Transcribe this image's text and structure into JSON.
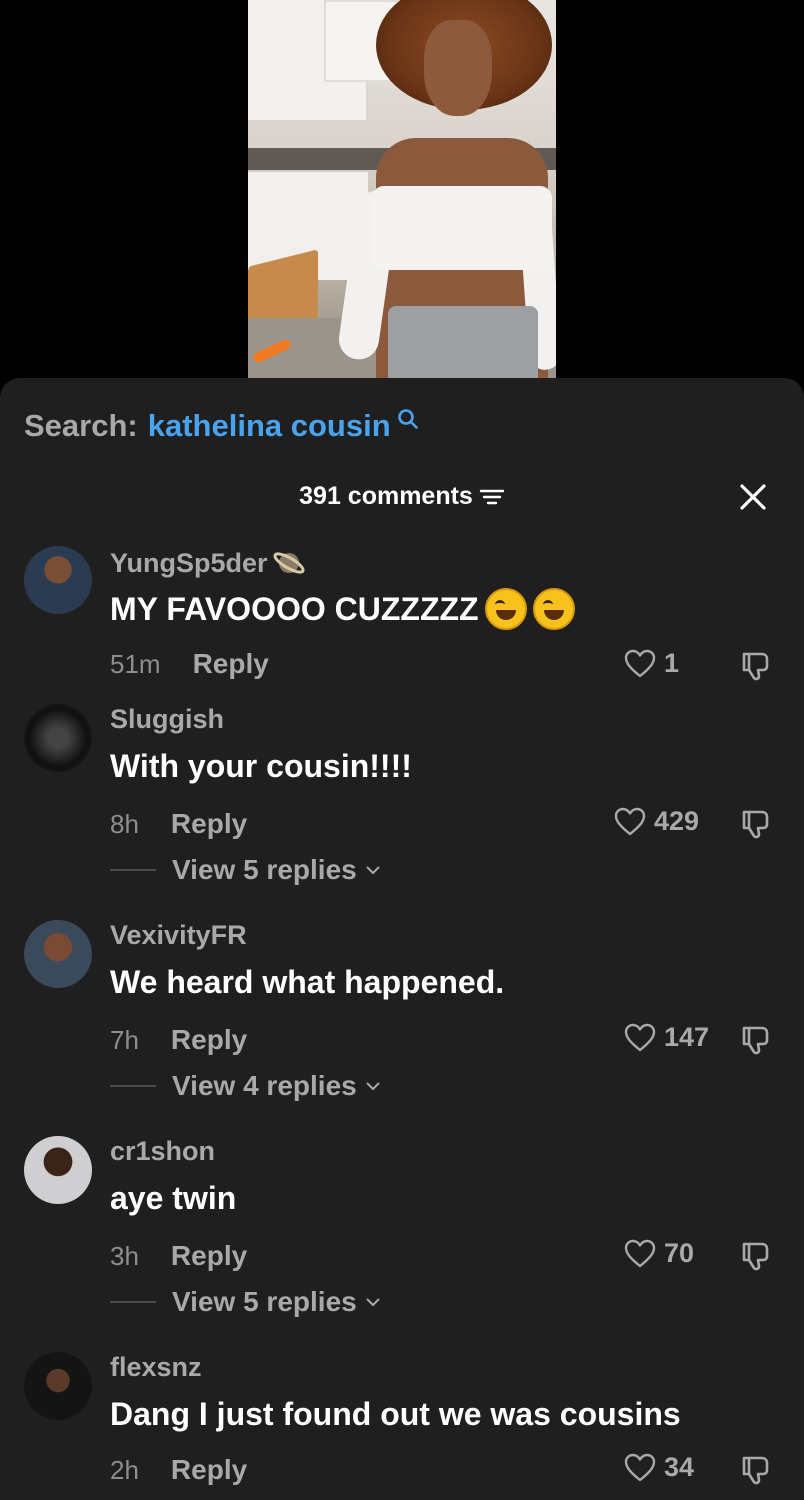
{
  "search": {
    "label": "Search:",
    "term": "kathelina cousin"
  },
  "header": {
    "comments_count": "391 comments"
  },
  "comments": [
    {
      "username": "YungSp5der",
      "text": "MY FAVOOOO CUZZZZZ",
      "time": "51m",
      "reply_label": "Reply",
      "likes": "1"
    },
    {
      "username": "Sluggish",
      "text": "With your cousin!!!!",
      "time": "8h",
      "reply_label": "Reply",
      "likes": "429",
      "view_replies": "View 5 replies"
    },
    {
      "username": "VexivityFR",
      "text": "We heard what happened.",
      "time": "7h",
      "reply_label": "Reply",
      "likes": "147",
      "view_replies": "View 4 replies"
    },
    {
      "username": "cr1shon",
      "text": "aye twin",
      "time": "3h",
      "reply_label": "Reply",
      "likes": "70",
      "view_replies": "View 5 replies"
    },
    {
      "username": "flexsnz",
      "text": "Dang I just found out we was cousins",
      "time": "2h",
      "reply_label": "Reply",
      "likes": "34"
    }
  ],
  "colors": {
    "sheet_bg": "#1f1f1f",
    "accent_blue": "#4aa3ef",
    "muted_text": "#a9a9a9"
  }
}
